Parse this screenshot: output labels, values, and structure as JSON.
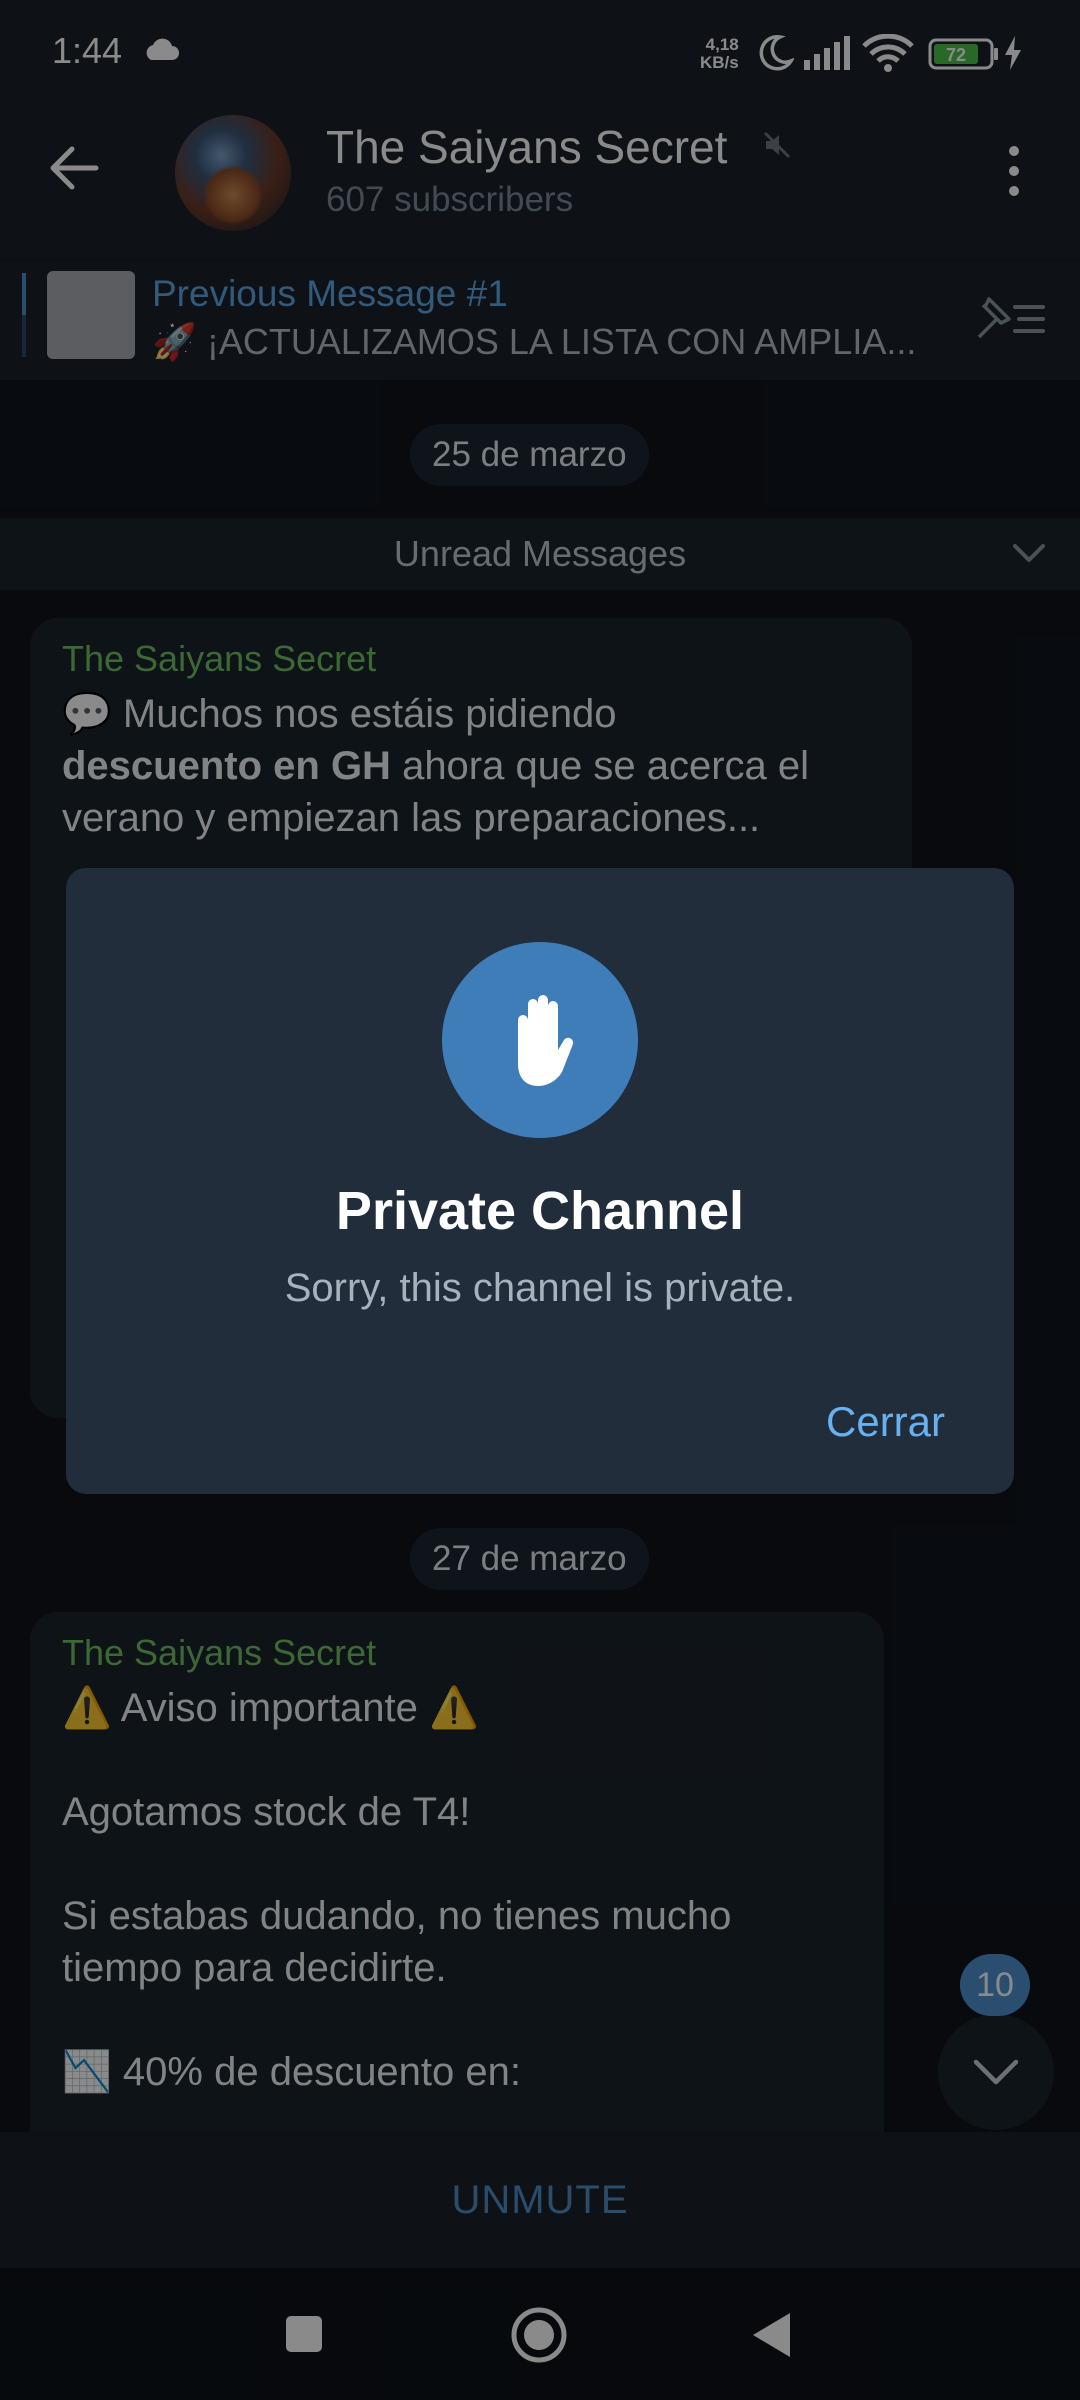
{
  "status_bar": {
    "time": "1:44",
    "net_speed_value": "4,18",
    "net_speed_unit": "KB/s",
    "battery": "72"
  },
  "header": {
    "title": "The Saiyans Secret",
    "subscribers": "607 subscribers"
  },
  "pinned": {
    "title": "Previous Message #1",
    "text": "🚀 ¡ACTUALIZAMOS LA LISTA CON AMPLIA..."
  },
  "chat": {
    "date_1": "25 de marzo",
    "unread_label": "Unread Messages",
    "message_1": {
      "author": "The Saiyans Secret",
      "line_1": "💬 Muchos nos estáis pidiendo",
      "line_2_bold": "descuento en GH",
      "line_2_rest": " ahora que se acerca el",
      "line_3": "verano y empiezan las preparaciones..."
    },
    "date_2": "27 de marzo",
    "message_2": {
      "author": "The Saiyans Secret",
      "line_1": "⚠️ Aviso importante ⚠️",
      "line_2": "Agotamos stock de T4!",
      "line_3": "Si estabas dudando, no tienes mucho",
      "line_4": "tiempo para decidirte.",
      "line_5": "📉 40% de descuento en:"
    },
    "unread_count": "10"
  },
  "bottom": {
    "unmute_label": "UNMUTE"
  },
  "dialog": {
    "title": "Private Channel",
    "text": "Sorry, this channel is private.",
    "button_label": "Cerrar"
  },
  "colors": {
    "accent": "#4d91d0",
    "author": "#6fc160",
    "dialog_bg": "#212d3b",
    "button": "#67b1f0"
  }
}
